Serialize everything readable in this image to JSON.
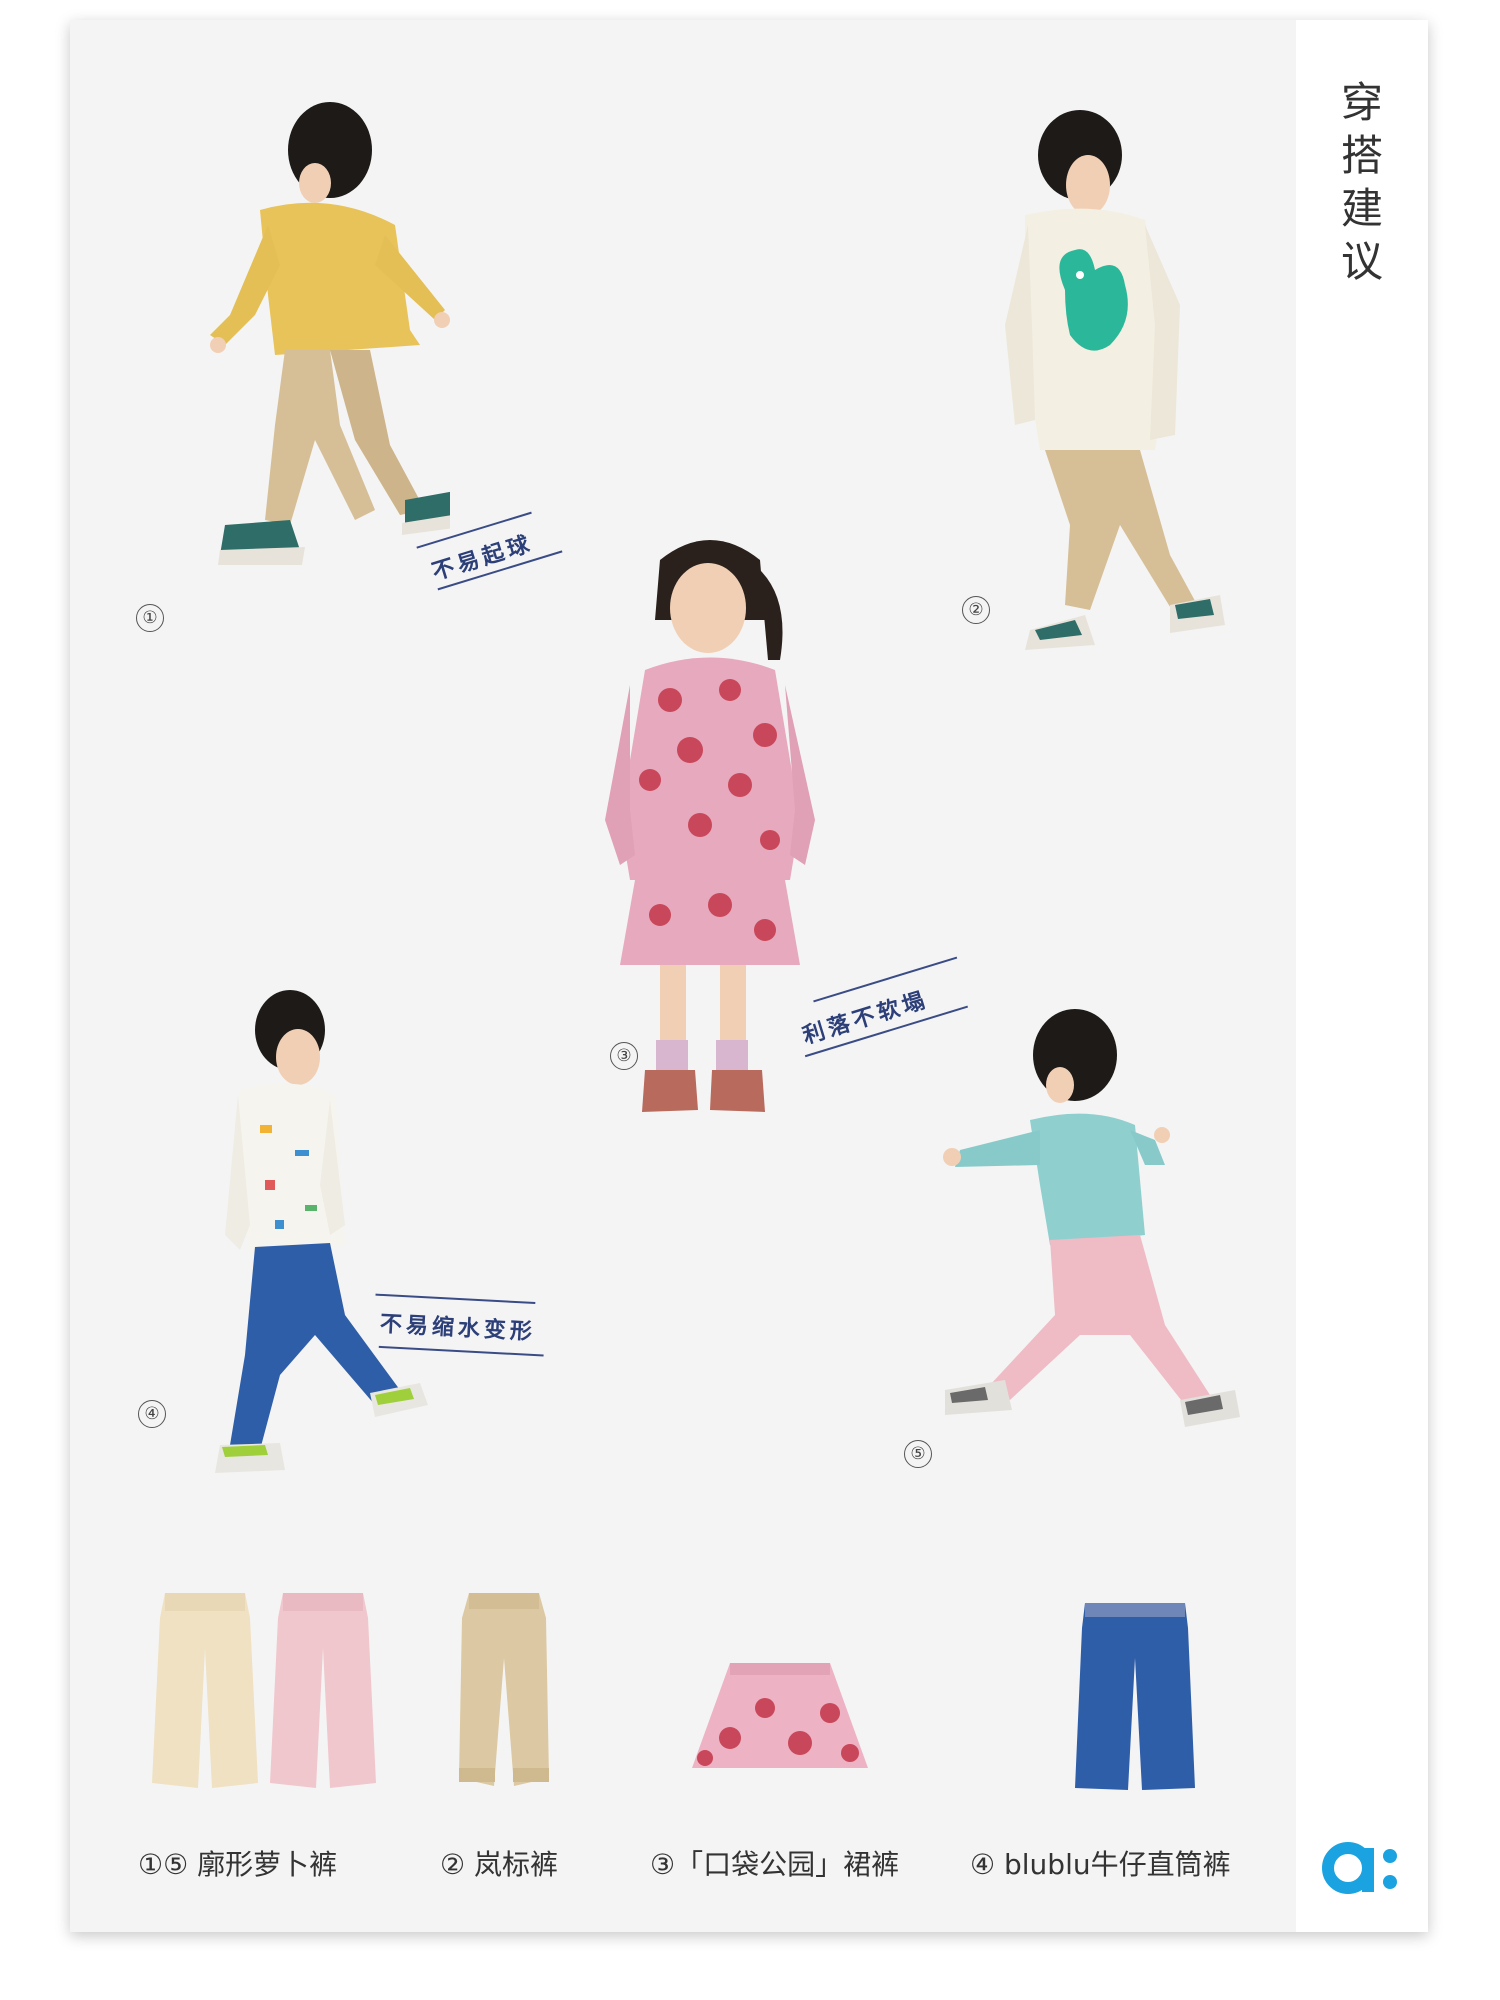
{
  "sidebar": {
    "title": [
      "穿",
      "搭",
      "建",
      "议"
    ]
  },
  "brand": {
    "logo_glyph": "a:",
    "color": "#1aa3e0"
  },
  "models": [
    {
      "number": "①",
      "label": "不易起球"
    },
    {
      "number": "②"
    },
    {
      "number": "③",
      "label": "利落不软塌"
    },
    {
      "number": "④",
      "label": "不易缩水变形"
    },
    {
      "number": "⑤"
    }
  ],
  "captions": [
    "①⑤ 廓形萝卜裤",
    "② 岚标裤",
    "③「口袋公园」裙裤",
    "④  blublu牛仔直筒裤"
  ],
  "colors": {
    "panel": "#f4f4f4",
    "yellow_top": "#e8c35a",
    "khaki": "#d6bf97",
    "cream_top": "#f3efe2",
    "teal": "#2bb89a",
    "pink_print": "#e7a9bd",
    "apple_red": "#c9475a",
    "denim": "#2f5ea8",
    "mint_top": "#8fd0cf",
    "pink_pants": "#efbcc6",
    "tag_blue": "#2c3f78"
  }
}
